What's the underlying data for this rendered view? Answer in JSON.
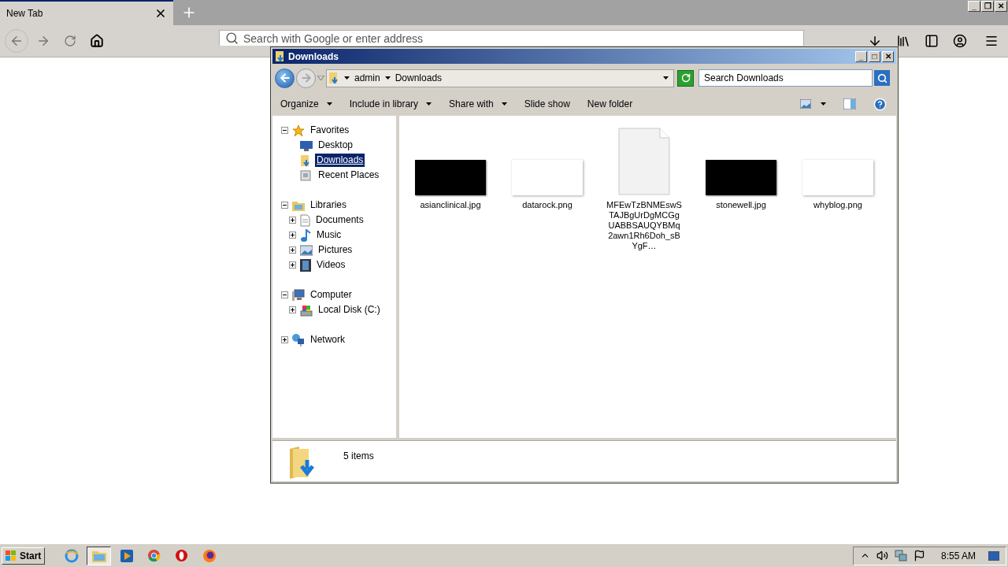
{
  "browser": {
    "tabs": [
      {
        "label": "New Tab",
        "selected": true
      }
    ],
    "address": {
      "placeholder": "Search with Google or enter address"
    },
    "window_buttons": [
      "_",
      "❐",
      "✕"
    ]
  },
  "explorer": {
    "title": "Downloads",
    "window_buttons": [
      "_",
      "□",
      "✕"
    ],
    "breadcrumb": [
      "admin",
      "Downloads"
    ],
    "search": {
      "placeholder": "Search Downloads"
    },
    "toolbar": [
      {
        "label": "Organize",
        "dropdown": true
      },
      {
        "label": "Include in library",
        "dropdown": true
      },
      {
        "label": "Share with",
        "dropdown": true
      },
      {
        "label": "Slide show",
        "dropdown": false
      },
      {
        "label": "New folder",
        "dropdown": false
      }
    ],
    "tree": [
      {
        "label": "Favorites",
        "kind": "star",
        "expanded": true,
        "children": [
          {
            "label": "Desktop",
            "kind": "desktop",
            "selected": false
          },
          {
            "label": "Downloads",
            "kind": "downloads",
            "selected": true
          },
          {
            "label": "Recent Places",
            "kind": "recent",
            "selected": false
          }
        ]
      },
      {
        "label": "Libraries",
        "kind": "libraries",
        "expanded": true,
        "children": [
          {
            "label": "Documents",
            "kind": "documents",
            "selected": false,
            "expanded": false
          },
          {
            "label": "Music",
            "kind": "music",
            "selected": false,
            "expanded": false
          },
          {
            "label": "Pictures",
            "kind": "pictures",
            "selected": false,
            "expanded": false
          },
          {
            "label": "Videos",
            "kind": "videos",
            "selected": false,
            "expanded": false
          }
        ]
      },
      {
        "label": "Computer",
        "kind": "computer",
        "expanded": true,
        "children": [
          {
            "label": "Local Disk (C:)",
            "kind": "disk",
            "selected": false,
            "expanded": false
          }
        ]
      },
      {
        "label": "Network",
        "kind": "network",
        "expanded": false
      }
    ],
    "files": [
      {
        "name": "asianclinical.jpg",
        "kind": "dark-image"
      },
      {
        "name": "datarock.png",
        "kind": "light-image"
      },
      {
        "name": "MFEwTzBNMEswSTAJBgUrDgMCGgUABBSAUQYBMq2awn1Rh6Doh_sBYgF…",
        "kind": "document"
      },
      {
        "name": "stonewell.jpg",
        "kind": "dark-image"
      },
      {
        "name": "whyblog.png",
        "kind": "light-image"
      }
    ],
    "status": "5 items"
  },
  "taskbar": {
    "start": "Start",
    "apps": [
      {
        "kind": "ie",
        "selected": false
      },
      {
        "kind": "explorer",
        "selected": true
      },
      {
        "kind": "media",
        "selected": false
      },
      {
        "kind": "chrome",
        "selected": false
      },
      {
        "kind": "opera",
        "selected": false
      },
      {
        "kind": "firefox",
        "selected": false
      }
    ],
    "clock": "8:55 AM"
  }
}
